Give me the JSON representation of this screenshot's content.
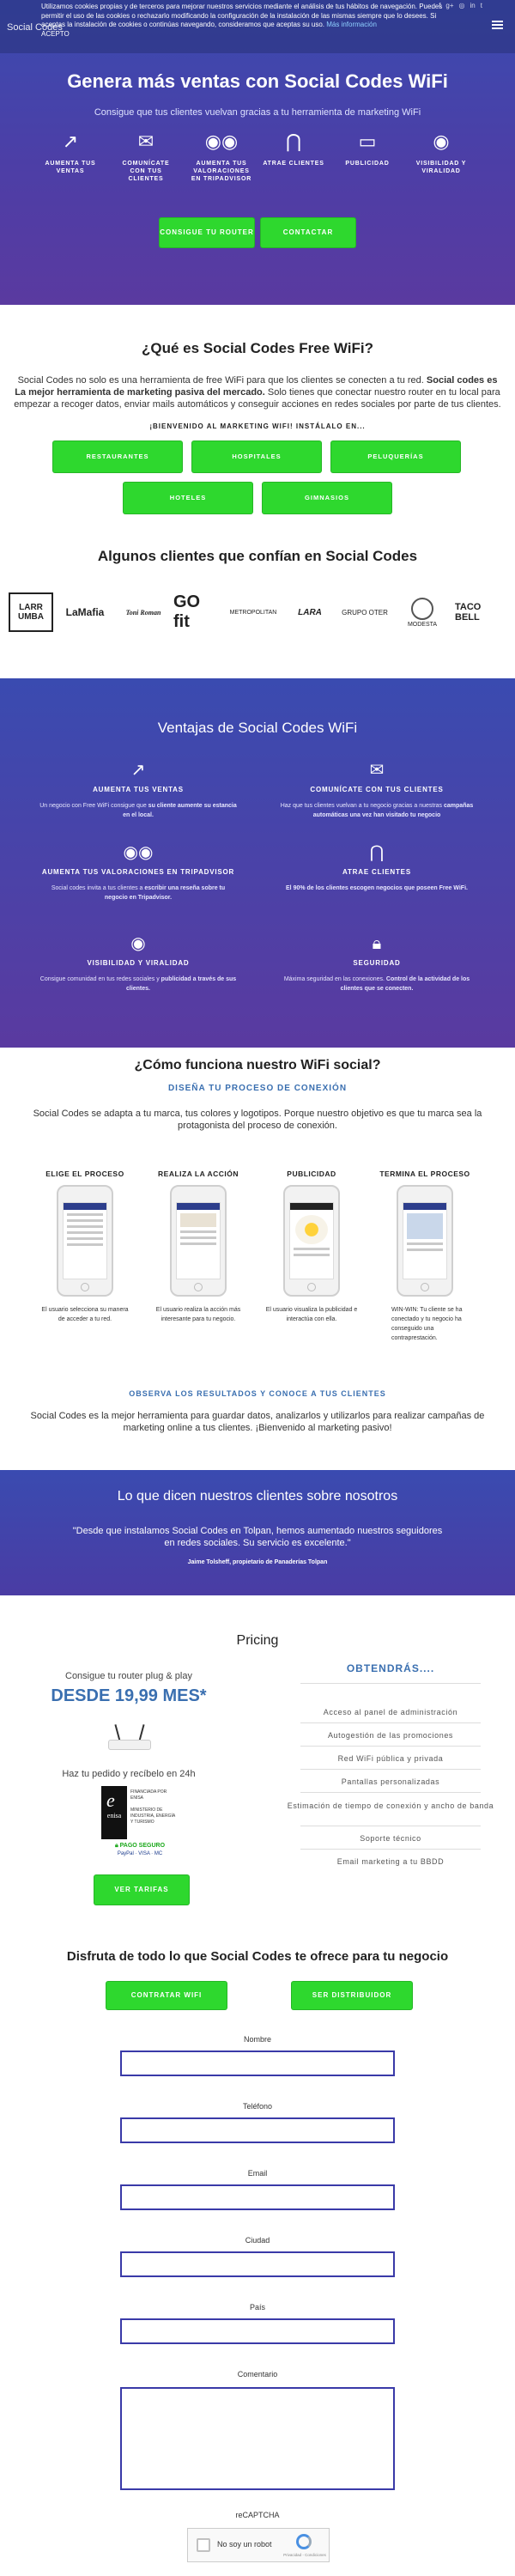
{
  "header": {
    "brand": "Social Codes",
    "social_icons": [
      "facebook-icon",
      "google-plus-icon",
      "instagram-icon",
      "linkedin-icon",
      "twitter-icon"
    ],
    "cookie_text": "Utilizamos cookies propias y de terceros para mejorar nuestros servicios mediante el análisis de tus hábitos de navegación. Puedes permitir el uso de las cookies o rechazarlo modificando la configuración de la instalación de las mismas siempre que lo desees. Si aceptas la instalación de cookies o continúas navegando, consideramos que aceptas su uso.",
    "cookie_link": "Más información",
    "cookie_accept": "ACEPTO"
  },
  "hero": {
    "title": "Genera más ventas con Social Codes WiFi",
    "subtitle": "Consigue que tus clientes vuelvan gracias a tu herramienta de marketing WiFi",
    "features": [
      {
        "label": "AUMENTA TUS VENTAS",
        "icon": "growth-icon"
      },
      {
        "label": "COMUNÍCATE CON TUS CLIENTES",
        "icon": "mail-icon"
      },
      {
        "label": "AUMENTA TUS VALORACIONES EN TRIPADVISOR",
        "icon": "tripadvisor-icon"
      },
      {
        "label": "ATRAE CLIENTES",
        "icon": "magnet-icon"
      },
      {
        "label": "PUBLICIDAD",
        "icon": "megaphone-icon"
      },
      {
        "label": "VISIBILIDAD Y VIRALIDAD",
        "icon": "eye-icon"
      }
    ],
    "btn_router": "CONSIGUE TU ROUTER",
    "btn_contact": "CONTACTAR"
  },
  "about": {
    "title": "¿Qué es Social Codes Free WiFi?",
    "text1": "Social Codes no solo es una herramienta de free WiFi para que los clientes se conecten a tu red.",
    "text_bold": "Social codes es La mejor herramienta de marketing pasiva del mercado.",
    "text2": "Solo tienes que conectar nuestro router en tu local para empezar a recoger datos, enviar mails automáticos y conseguir acciones en redes sociales por parte de tus clientes.",
    "install": "¡BIENVENIDO AL MARKETING WIFI! INSTÁLALO EN...",
    "categories": [
      "RESTAURANTES",
      "HOSPITALES",
      "PELUQUERÍAS",
      "HOTELES",
      "GIMNASIOS"
    ]
  },
  "clients": {
    "title": "Algunos clientes que confían en Social Codes",
    "logos": [
      "LARR UMBA",
      "LaMafia",
      "Toni Roman",
      "GO fit",
      "METROPOLITAN",
      "LARA",
      "GRUPO OTER",
      "MODESTA",
      "TACO BELL"
    ]
  },
  "advantages": {
    "title": "Ventajas de Social Codes WiFi",
    "items": [
      {
        "icon": "growth-icon",
        "title": "AUMENTA TUS VENTAS",
        "desc_a": "Un negocio con Free WiFi consigue que",
        "desc_b": "su cliente aumente su estancia en el local."
      },
      {
        "icon": "mail-icon",
        "title": "COMUNÍCATE CON TUS CLIENTES",
        "desc_a": "Haz que tus clientes vuelvan a tu negocio gracias a nuestras",
        "desc_b": "campañas automáticas una vez han visitado tu negocio"
      },
      {
        "icon": "tripadvisor-icon",
        "title": "AUMENTA TUS VALORACIONES EN TRIPADVISOR",
        "desc_a": "Social codes invita a tus clientes a",
        "desc_b": "escribir una reseña sobre tu negocio en Tripadvisor."
      },
      {
        "icon": "magnet-icon",
        "title": "ATRAE CLIENTES",
        "desc_a": "",
        "desc_b": "El 90% de los clientes escogen negocios que poseen Free WiFi."
      },
      {
        "icon": "eye-icon",
        "title": "VISIBILIDAD Y VIRALIDAD",
        "desc_a": "Consigue comunidad en tus redes sociales y",
        "desc_b": "publicidad a través de sus clientes."
      },
      {
        "icon": "lock-icon",
        "title": "SEGURIDAD",
        "desc_a": "Máxima seguridad en las conexiones.",
        "desc_b": "Control de la actividad de los clientes que se conecten."
      }
    ]
  },
  "how": {
    "title": "¿Cómo funciona nuestro WiFi social?",
    "subtitle": "DISEÑA TU PROCESO DE CONEXIÓN",
    "text": "Social Codes se adapta a tu marca, tus colores y logotipos. Porque nuestro objetivo es que tu marca sea la protagonista del proceso de conexión.",
    "steps": [
      {
        "title": "ELIGE EL PROCESO",
        "desc": "El usuario selecciona su manera de acceder a tu red."
      },
      {
        "title": "REALIZA LA ACCIÓN",
        "desc": "El usuario realiza la acción más interesante para tu negocio."
      },
      {
        "title": "PUBLICIDAD",
        "desc": "El usuario visualiza la publicidad e interactúa con ella."
      },
      {
        "title": "TERMINA EL PROCESO",
        "desc": "WIN-WIN: Tu cliente se ha conectado y tu negocio ha conseguido una contraprestación."
      }
    ],
    "results_title": "OBSERVA LOS RESULTADOS Y CONOCE A TUS CLIENTES",
    "results_text": "Social Codes es la mejor herramienta para guardar datos, analizarlos y utilizarlos para realizar campañas de marketing online a tus clientes. ¡Bienvenido al marketing pasivo!"
  },
  "testimonials": {
    "title": "Lo que dicen nuestros clientes sobre nosotros",
    "quote": "\"Desde que instalamos Social Codes en Tolpan, hemos aumentado nuestros seguidores en redes sociales. Su servicio es excelente.\"",
    "author": "Jaime Tolsheff, propietario de Panaderías Tolpan"
  },
  "pricing": {
    "title": "Pricing",
    "router_text": "Consigue tu router plug & play",
    "price": "DESDE 19,99 MES*",
    "delivery": "Haz tu pedido y recíbelo en 24h",
    "enisa": "enisa",
    "enisa_text": "FINANCIADA POR ENISA",
    "enisa_sub": "MINISTERIO DE INDUSTRIA, ENERGÍA Y TURISMO",
    "secure": "PAGO SEGURO",
    "payment": "PayPal · VISA · MC",
    "btn": "VER TARIFAS",
    "includes_title": "OBTENDRÁS....",
    "includes": [
      "Acceso al panel de administración",
      "Autogestión de las promociones",
      "Red WiFi pública y privada",
      "Pantallas personalizadas",
      "Estimación de tiempo de conexión y ancho de banda",
      "Soporte técnico",
      "Email marketing a tu BBDD"
    ]
  },
  "contact": {
    "title": "Disfruta de todo lo que Social Codes te ofrece para tu negocio",
    "btn_contract": "CONTRATAR WIFI",
    "btn_dist": "SER DISTRIBUIDOR",
    "fields": [
      "Nombre",
      "Teléfono",
      "Email",
      "Ciudad",
      "País",
      "Comentario"
    ],
    "captcha_label": "reCAPTCHA",
    "captcha_check": "No soy un robot",
    "captcha_sub": "Privacidad - Condiciones"
  }
}
